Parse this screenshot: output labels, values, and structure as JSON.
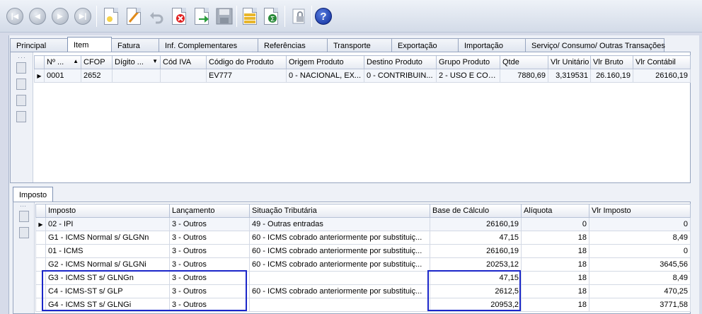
{
  "toolbar": {
    "buttons": [
      {
        "name": "first-record-button",
        "icon": "skip-first-icon",
        "glyph": "|◀"
      },
      {
        "name": "previous-record-button",
        "icon": "previous-icon",
        "glyph": "◀"
      },
      {
        "name": "next-record-button",
        "icon": "next-icon",
        "glyph": "▶"
      },
      {
        "name": "last-record-button",
        "icon": "skip-last-icon",
        "glyph": "▶|"
      },
      {
        "name": "new-button",
        "icon": "new-document-icon"
      },
      {
        "name": "edit-button",
        "icon": "edit-pencil-icon"
      },
      {
        "name": "undo-button",
        "icon": "undo-icon"
      },
      {
        "name": "delete-button",
        "icon": "delete-icon"
      },
      {
        "name": "confirm-button",
        "icon": "confirm-arrow-icon"
      },
      {
        "name": "save-button",
        "icon": "save-disk-icon"
      },
      {
        "name": "report-button",
        "icon": "report-icon"
      },
      {
        "name": "totals-button",
        "icon": "sum-icon"
      },
      {
        "name": "lock-button",
        "icon": "lock-icon"
      },
      {
        "name": "help-button",
        "icon": "help-icon",
        "glyph": "?"
      }
    ]
  },
  "tabs": [
    {
      "label": "Principal",
      "active": false
    },
    {
      "label": "Item",
      "active": true
    },
    {
      "label": "Fatura",
      "active": false
    },
    {
      "label": "Inf. Complementares",
      "active": false
    },
    {
      "label": "Referências",
      "active": false
    },
    {
      "label": "Transporte",
      "active": false
    },
    {
      "label": "Exportação",
      "active": false
    },
    {
      "label": "Importação",
      "active": false
    },
    {
      "label": "Serviço/ Consumo/ Outras Transações",
      "active": false
    }
  ],
  "items_grid": {
    "columns": [
      "Nº ...",
      "CFOP",
      "Dígito ...",
      "Cód IVA",
      "Código do Produto",
      "Origem Produto",
      "Destino Produto",
      "Grupo Produto",
      "Qtde",
      "Vlr Unitário",
      "Vlr Bruto",
      "Vlr Contábil"
    ],
    "rows": [
      [
        "0001",
        "2652",
        "",
        "",
        "EV777",
        "0 - NACIONAL, EX...",
        "0 - CONTRIBUIN...",
        "2 - USO E CON...",
        "7880,69",
        "3,319531",
        "26.160,19",
        "26160,19"
      ]
    ]
  },
  "subtab": {
    "label": "Imposto"
  },
  "tax_grid": {
    "columns": [
      "Imposto",
      "Lançamento",
      "Situação Tributária",
      "Base de Cálculo",
      "Alíquota",
      "Vlr Imposto"
    ],
    "rows": [
      [
        "02 - IPI",
        "3 - Outros",
        "49 - Outras entradas",
        "26160,19",
        "0",
        "0"
      ],
      [
        "G1 - ICMS Normal s/ GLGNn",
        "3 - Outros",
        "60 - ICMS cobrado anteriormente por substituiç...",
        "47,15",
        "18",
        "8,49"
      ],
      [
        "01 - ICMS",
        "3 - Outros",
        "60 - ICMS cobrado anteriormente por substituiç...",
        "26160,19",
        "18",
        "0"
      ],
      [
        "G2 - ICMS Normal s/ GLGNi",
        "3 - Outros",
        "60 - ICMS cobrado anteriormente por substituiç...",
        "20253,12",
        "18",
        "3645,56"
      ],
      [
        "G3 - ICMS ST s/ GLNGn",
        "3 - Outros",
        "",
        "47,15",
        "18",
        "8,49"
      ],
      [
        "C4 - ICMS-ST s/ GLP",
        "3 - Outros",
        "60 - ICMS cobrado anteriormente por substituiç...",
        "2612,5",
        "18",
        "470,25"
      ],
      [
        "G4 - ICMS ST s/ GLNGi",
        "3 - Outros",
        "",
        "20953,2",
        "18",
        "3771,58"
      ]
    ]
  }
}
